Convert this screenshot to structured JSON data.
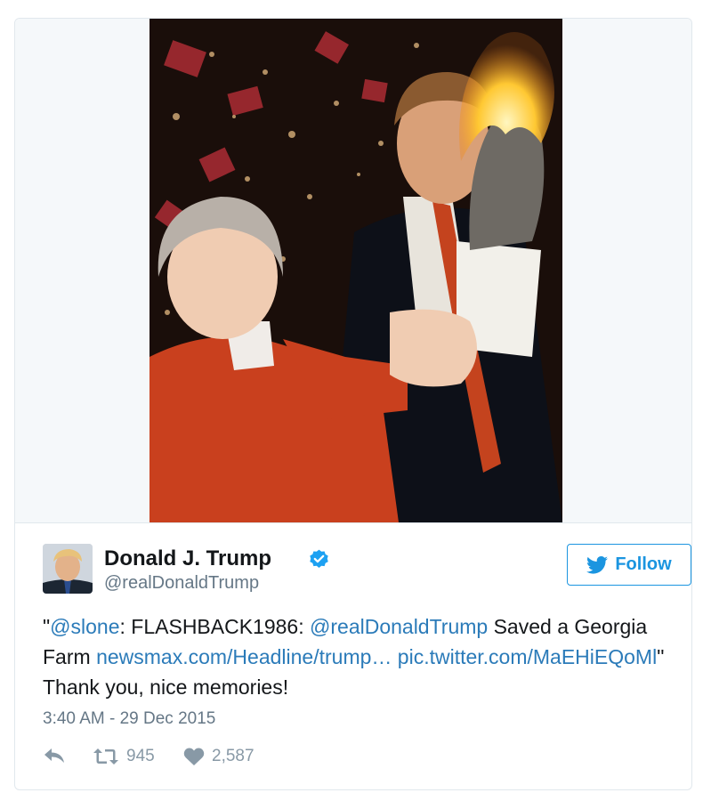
{
  "tweet": {
    "author": {
      "name": "Donald J. Trump",
      "handle": "@realDonaldTrump",
      "verified": true
    },
    "follow_label": "Follow",
    "text": {
      "open_quote": "\"",
      "mention_1": "@slone",
      "part_1": ": FLASHBACK1986: ",
      "mention_2": "@realDonaldTrump",
      "part_2": " Saved a Georgia Farm ",
      "link_1": "newsmax.com/Headline/trump…",
      "link_2": "pic.twitter.com/MaEHiEQoMl",
      "part_3": "\" Thank you, nice memories!"
    },
    "timestamp": "3:40 AM - 29 Dec 2015",
    "stats": {
      "retweets": "945",
      "likes": "2,587"
    }
  },
  "colors": {
    "link": "#2b7bb9",
    "accent": "#1b95e0",
    "muted": "#657786",
    "icon_gray": "#8899a6",
    "border": "#e1e8ed"
  },
  "icons": {
    "verified": "verified-badge-icon",
    "follow": "bird-icon",
    "reply": "reply-icon",
    "retweet": "retweet-icon",
    "like": "heart-icon"
  }
}
